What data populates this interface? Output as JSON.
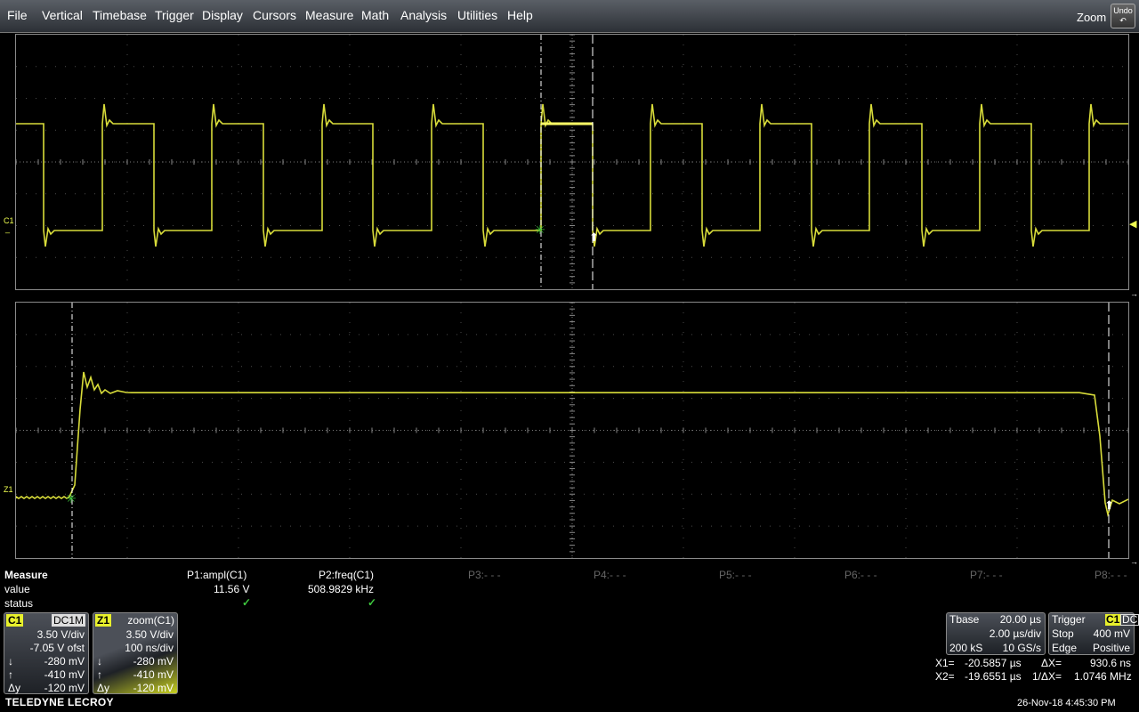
{
  "menu": [
    "File",
    "Vertical",
    "Timebase",
    "Trigger",
    "Display",
    "Cursors",
    "Measure",
    "Math",
    "Analysis",
    "Utilities",
    "Help"
  ],
  "zoom_label": "Zoom",
  "undo_label": "Undo",
  "traces": {
    "top_label": "C1",
    "bottom_label": "Z1",
    "color": "#d8dc3a"
  },
  "measure": {
    "title": "Measure",
    "row_value": "value",
    "row_status": "status",
    "params": [
      {
        "name": "P1:ampl(C1)",
        "value": "11.56 V",
        "status": "✓"
      },
      {
        "name": "P2:freq(C1)",
        "value": "508.9829 kHz",
        "status": "✓"
      },
      {
        "name": "P3:- - -",
        "value": "",
        "status": ""
      },
      {
        "name": "P4:- - -",
        "value": "",
        "status": ""
      },
      {
        "name": "P5:- - -",
        "value": "",
        "status": ""
      },
      {
        "name": "P6:- - -",
        "value": "",
        "status": ""
      },
      {
        "name": "P7:- - -",
        "value": "",
        "status": ""
      },
      {
        "name": "P8:- - -",
        "value": "",
        "status": ""
      }
    ]
  },
  "c1_box": {
    "tag": "C1",
    "coupling": "DC1M",
    "vdiv": "3.50 V/div",
    "offset": "-7.05 V ofst",
    "down_sym": "↓",
    "down": "-280 mV",
    "up_sym": "↑",
    "up": "-410 mV",
    "dy_sym": "Δy",
    "dy": "-120 mV"
  },
  "z1_box": {
    "tag": "Z1",
    "source": "zoom(C1)",
    "vdiv": "3.50 V/div",
    "tdiv": "100 ns/div",
    "down_sym": "↓",
    "down": "-280 mV",
    "up_sym": "↑",
    "up": "-410 mV",
    "dy_sym": "Δy",
    "dy": "-120 mV"
  },
  "timebase": {
    "label": "Tbase",
    "delay": "20.00 µs",
    "tdiv": "2.00 µs/div",
    "samples": "200 kS",
    "rate": "10 GS/s"
  },
  "trigger": {
    "label": "Trigger",
    "src": "C1",
    "coupling": "DC",
    "mode": "Stop",
    "level": "400 mV",
    "type": "Edge",
    "slope": "Positive"
  },
  "cursors": {
    "x1_label": "X1=",
    "x1": "-20.5857 µs",
    "dx_label": "ΔX=",
    "dx": "930.6 ns",
    "x2_label": "X2=",
    "x2": "-19.6551 µs",
    "inv_label": "1/ΔX=",
    "inv": "1.0746 MHz"
  },
  "brand": "TELEDYNE LECROY",
  "datetime": "26-Nov-18 4:45:30 PM"
}
